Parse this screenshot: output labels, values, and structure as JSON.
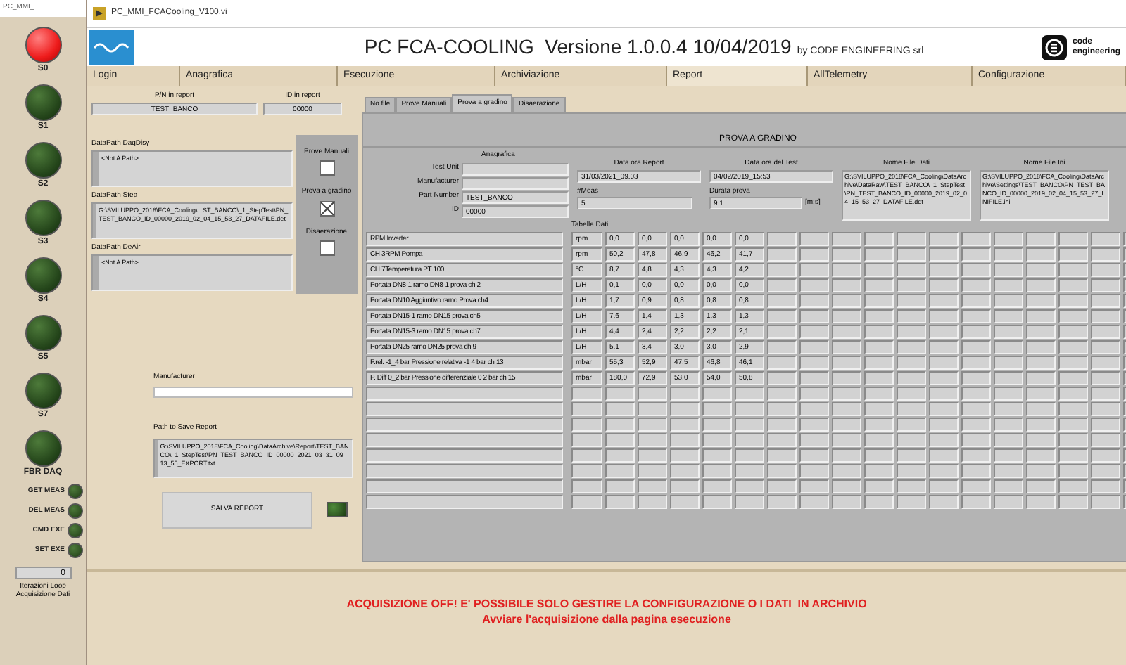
{
  "side_panel": {
    "title": "PC_MMI_...",
    "indicators": [
      {
        "label": "S0",
        "on": true
      },
      {
        "label": "S1",
        "on": false
      },
      {
        "label": "S2",
        "on": false
      },
      {
        "label": "S3",
        "on": false
      },
      {
        "label": "S4",
        "on": false
      },
      {
        "label": "S5",
        "on": false
      },
      {
        "label": "S7",
        "on": false
      },
      {
        "label": "FBR DAQ",
        "on": false
      }
    ],
    "small_indicators": [
      {
        "label": "GET MEAS",
        "on": false
      },
      {
        "label": "DEL MEAS",
        "on": false
      },
      {
        "label": "CMD EXE",
        "on": false
      },
      {
        "label": "SET EXE",
        "on": false
      }
    ],
    "counter": {
      "value": "0",
      "label": "Iterazioni Loop Acquisizione Dati"
    }
  },
  "window": {
    "title": "PC_MMI_FCACooling_V100.vi"
  },
  "header": {
    "title": "PC FCA-COOLING  Versione 1.0.0.4 10/04/2019",
    "byline": "by CODE ENGINEERING srl",
    "brand": "code engineering"
  },
  "tabs": [
    {
      "label": "Login",
      "selected": false
    },
    {
      "label": "Anagrafica",
      "selected": false
    },
    {
      "label": "Esecuzione",
      "selected": false
    },
    {
      "label": "Archiviazione",
      "selected": false
    },
    {
      "label": "Report",
      "selected": true
    },
    {
      "label": "AllTelemetry",
      "selected": false
    },
    {
      "label": "Configurazione",
      "selected": false
    }
  ],
  "report_panel": {
    "pn_label": "P/N in report",
    "pn_value": "TEST_BANCO",
    "id_label": "ID in report",
    "id_value": "00000",
    "paths": [
      {
        "label": "DataPath DaqDisy",
        "value": "<Not A Path>"
      },
      {
        "label": "DataPath Step",
        "value": "G:\\SVILUPPO_2018\\FCA_Cooling\\...ST_BANCO\\_1_StepTest\\PN_TEST_BANCO_ID_00000_2019_02_04_15_53_27_DATAFILE.det"
      },
      {
        "label": "DataPath DeAir",
        "value": "<Not A Path>"
      }
    ],
    "test_types": [
      {
        "label": "Prove Manuali",
        "checked": false
      },
      {
        "label": "Prova a gradino",
        "checked": true
      },
      {
        "label": "Disaerazione",
        "checked": false
      }
    ],
    "manufacturer_label": "Manufacturer",
    "save_path_label": "Path to Save Report",
    "save_path": "G:\\SVILUPPO_2018\\FCA_Cooling\\DataArchive\\Report\\TEST_BANCO\\_1_StepTest\\PN_TEST_BANCO_ID_00000_2021_03_31_09_13_55_EXPORT.txt",
    "save_button": "SALVA REPORT",
    "save_led_on": false
  },
  "sub_tabs": [
    {
      "label": "No file",
      "selected": false
    },
    {
      "label": "Prove Manuali",
      "selected": false
    },
    {
      "label": "Prova a gradino",
      "selected": true
    },
    {
      "label": "Disaerazione",
      "selected": false
    }
  ],
  "step_test": {
    "title": "PROVA A GRADINO",
    "anagrafica_title": "Anagrafica",
    "anagrafica": [
      {
        "label": "Test Unit"
      },
      {
        "label": "Manufacturer"
      },
      {
        "label": "Part Number",
        "value": "TEST_BANCO"
      },
      {
        "label": "ID",
        "value": "00000"
      }
    ],
    "report_time_label": "Data ora Report",
    "report_time": "31/03/2021_09.03",
    "test_time_label": "Data ora del Test",
    "test_time": "04/02/2019_15:53",
    "meas_label": "#Meas",
    "meas": "5",
    "duration_label": "Durata prova",
    "duration": "9.1",
    "duration_unit": "[m:s]",
    "data_file_label": "Nome File Dati",
    "data_file": "G:\\SVILUPPO_2018\\FCA_Cooling\\DataArchive\\DataRaw\\TEST_BANCO\\_1_StepTest\\PN_TEST_BANCO_ID_00000_2019_02_04_15_53_27_DATAFILE.det",
    "ini_file_label": "Nome File Ini",
    "ini_file": "G:\\SVILUPPO_2018\\FCA_Cooling\\DataArchive\\Settings\\TEST_BANCO\\PN_TEST_BANCO_ID_00000_2019_02_04_15_53_27_INIFILE.ini",
    "table_label": "Tabella Dati",
    "rows": [
      {
        "name": "RPM Inverter",
        "unit": "rpm",
        "values": [
          "0,0",
          "0,0",
          "0,0",
          "0,0",
          "0,0"
        ]
      },
      {
        "name": "CH 3RPM Pompa",
        "unit": "rpm",
        "values": [
          "50,2",
          "47,8",
          "46,9",
          "46,2",
          "41,7"
        ]
      },
      {
        "name": "CH 7Temperatura PT 100",
        "unit": "°C",
        "values": [
          "8,7",
          "4,8",
          "4,3",
          "4,3",
          "4,2"
        ]
      },
      {
        "name": "Portata DN8-1 ramo DN8-1 prova ch 2",
        "unit": "L/H",
        "values": [
          "0,1",
          "0,0",
          "0,0",
          "0,0",
          "0,0"
        ]
      },
      {
        "name": "Portata DN10 Aggiuntivo ramo Prova ch4",
        "unit": "L/H",
        "values": [
          "1,7",
          "0,9",
          "0,8",
          "0,8",
          "0,8"
        ]
      },
      {
        "name": "Portata DN15-1 ramo DN15 prova ch5",
        "unit": "L/H",
        "values": [
          "7,6",
          "1,4",
          "1,3",
          "1,3",
          "1,3"
        ]
      },
      {
        "name": "Portata DN15-3 ramo DN15 prova ch7",
        "unit": "L/H",
        "values": [
          "4,4",
          "2,4",
          "2,2",
          "2,2",
          "2,1"
        ]
      },
      {
        "name": "Portata DN25 ramo DN25 prova ch 9",
        "unit": "L/H",
        "values": [
          "5,1",
          "3,4",
          "3,0",
          "3,0",
          "2,9"
        ]
      },
      {
        "name": "P.rel. -1_4 bar Pressione relativa -1 4 bar ch 13",
        "unit": "mbar",
        "values": [
          "55,3",
          "52,9",
          "47,5",
          "46,8",
          "46,1"
        ]
      },
      {
        "name": "P. Diff 0_2 bar Pressione differenziale 0 2 bar ch 15",
        "unit": "mbar",
        "values": [
          "180,0",
          "72,9",
          "53,0",
          "54,0",
          "50,8"
        ]
      }
    ]
  },
  "messages": [
    "ACQUISIZIONE OFF! E' POSSIBILE SOLO GESTIRE LA CONFIGURAZIONE O I DATI  IN ARCHIVIO",
    "Avviare l'acquisizione dalla pagina esecuzione"
  ]
}
